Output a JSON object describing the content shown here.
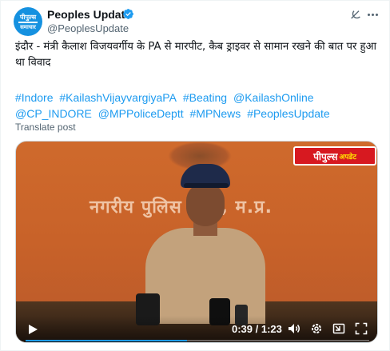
{
  "author": {
    "avatar_line1": "पीपुल्स",
    "avatar_line2": "समाचार",
    "name": "Peoples Update",
    "handle": "@PeoplesUpdate",
    "verified_icon": "verified-badge-icon",
    "accent_color": "#1d9bf0"
  },
  "header_icons": [
    "grok-icon",
    "more-icon"
  ],
  "tweet": {
    "text": "इंदौर - मंत्री कैलाश विजयवर्गीय के PA से मारपीट, कैब ड्राइवर से सामान रखने की बात पर हुआ था विवाद",
    "hashtags": [
      "#Indore",
      "#KailashVijayvargiyaPA",
      "#Beating",
      "@KailashOnline",
      "@CP_INDORE",
      "@MPPoliceDeptt",
      "#MPNews",
      "#PeoplesUpdate"
    ],
    "translate_label": "Translate post"
  },
  "video": {
    "banner_text": "नगरीय पुलिस इंदौर, म.प्र.",
    "logo_main": "पीपुल्स",
    "logo_sub": "अपडेट",
    "time": "0:39 / 1:23",
    "progress": 0.47,
    "control_icons": [
      "play-icon",
      "volume-icon",
      "settings-icon",
      "picture-in-picture-icon",
      "fullscreen-icon"
    ]
  }
}
